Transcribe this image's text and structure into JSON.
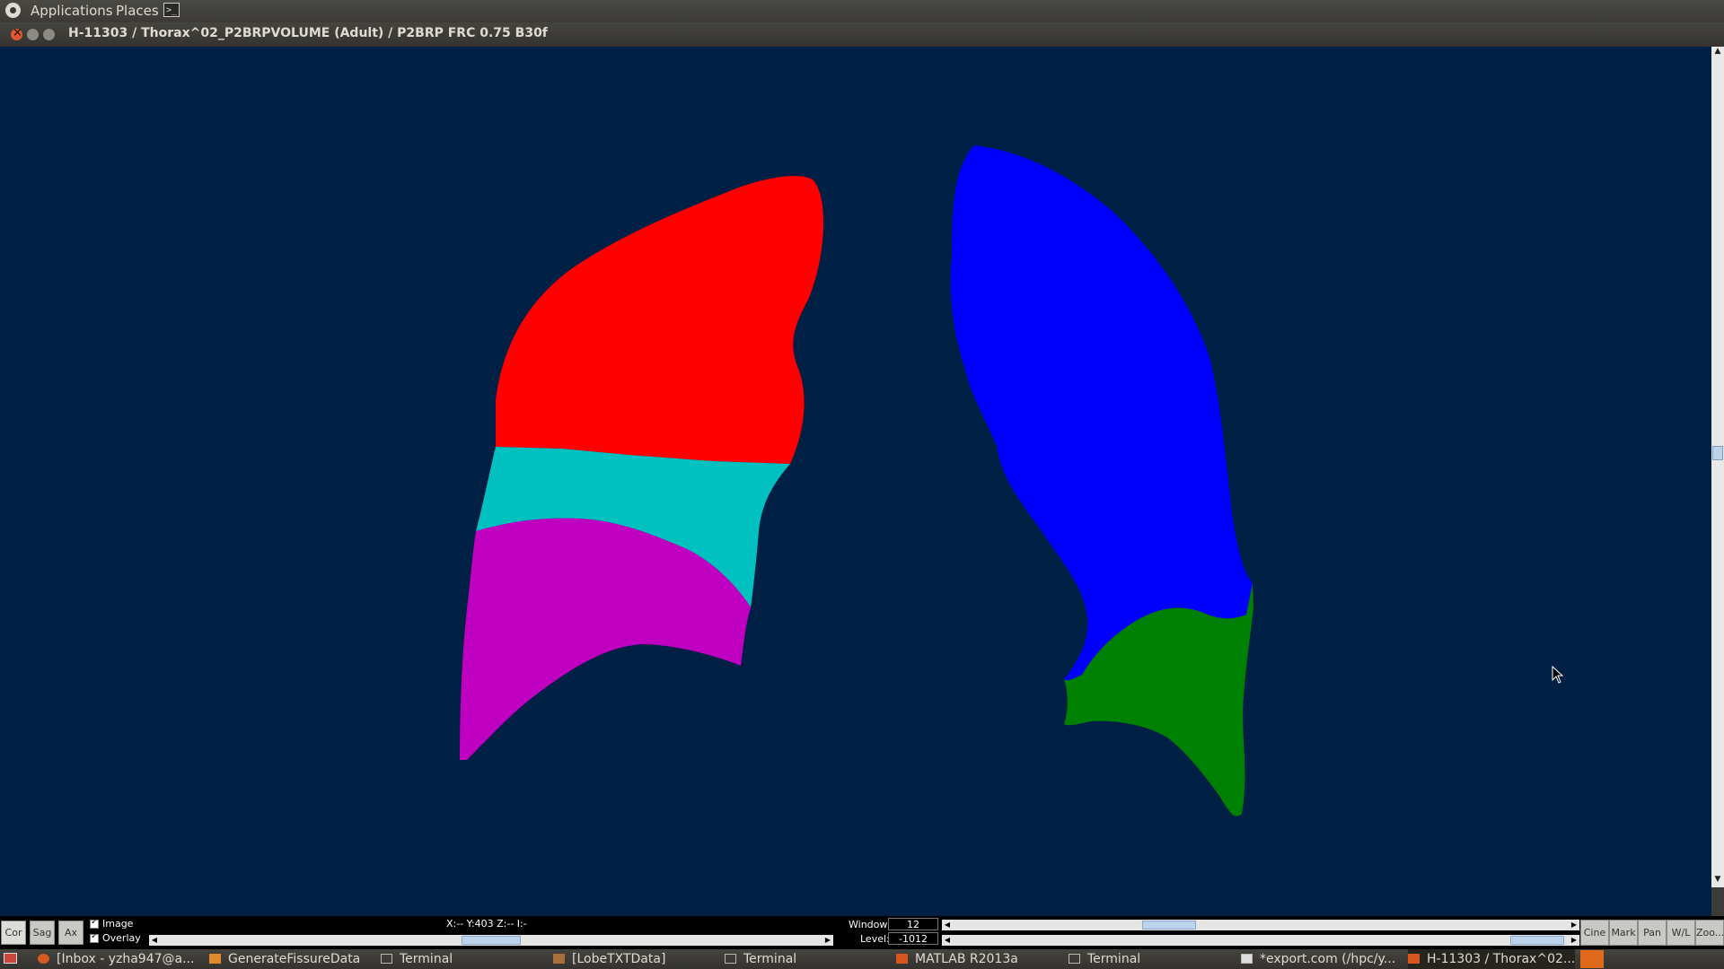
{
  "top_panel": {
    "applications": "Applications",
    "places": "Places"
  },
  "window": {
    "title": "H-11303 / Thorax^02_P2BRPVOLUME (Adult) / P2BRP FRC 0.75  B30f"
  },
  "lobes": {
    "right_upper": "#ff0000",
    "right_middle": "#00c0c0",
    "right_lower": "#c000c0",
    "left_upper": "#0000ff",
    "left_lower": "#008000",
    "background": "#001f45"
  },
  "controls": {
    "view_buttons": [
      "Cor",
      "Sag",
      "Ax"
    ],
    "image_label": "Image",
    "overlay_label": "Overlay",
    "coords": "X:-- Y:403 Z:-- I:-",
    "window_label": "Window:",
    "window_value": "12",
    "level_label": "Level:",
    "level_value": "-1012",
    "tool_buttons": [
      "Cine",
      "Mark",
      "Pan",
      "W/L",
      "Zoo..."
    ]
  },
  "taskbar": {
    "items": [
      "[Inbox - yzha947@a...",
      "GenerateFissureData",
      "Terminal",
      "[LobeTXTData]",
      "Terminal",
      "MATLAB R2013a",
      "Terminal",
      "*export.com (/hpc/y...",
      "H-11303 / Thorax^02..."
    ]
  }
}
